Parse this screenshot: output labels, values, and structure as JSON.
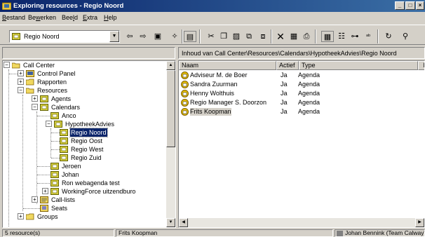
{
  "window": {
    "title": "Exploring resources - Regio Noord"
  },
  "menu": [
    {
      "pre": "",
      "u": "B",
      "post": "estand"
    },
    {
      "pre": "Be",
      "u": "w",
      "post": "erken"
    },
    {
      "pre": "Bee",
      "u": "l",
      "post": "d"
    },
    {
      "pre": "",
      "u": "E",
      "post": "xtra"
    },
    {
      "pre": "",
      "u": "H",
      "post": "elp"
    }
  ],
  "toolbar": {
    "location_value": "Regio Noord"
  },
  "path": {
    "text": "Inhoud van Call Center\\Resources\\Calendars\\HypotheekAdvies\\Regio Noord"
  },
  "tree": [
    {
      "label": "Call Center",
      "icon": "folder-open-icon"
    },
    {
      "label": "Control Panel",
      "icon": "control-panel-icon"
    },
    {
      "label": "Rapporten",
      "icon": "folder-icon"
    },
    {
      "label": "Resources",
      "icon": "folder-open-icon"
    },
    {
      "label": "Agents",
      "icon": "resource-icon"
    },
    {
      "label": "Calendars",
      "icon": "resource-icon"
    },
    {
      "label": "Anco",
      "icon": "resource-icon"
    },
    {
      "label": "HypotheekAdvies",
      "icon": "resource-icon"
    },
    {
      "label": "Regio Noord",
      "icon": "resource-icon"
    },
    {
      "label": "Regio Oost",
      "icon": "resource-icon"
    },
    {
      "label": "Regio West",
      "icon": "resource-icon"
    },
    {
      "label": "Regio Zuid",
      "icon": "resource-icon"
    },
    {
      "label": "Jeroen",
      "icon": "resource-icon"
    },
    {
      "label": "Johan",
      "icon": "resource-icon"
    },
    {
      "label": "Ron webagenda test",
      "icon": "resource-icon"
    },
    {
      "label": "WorkingForce uitzendburo",
      "icon": "resource-icon"
    },
    {
      "label": "Call-lists",
      "icon": "call-list-icon"
    },
    {
      "label": "Seats",
      "icon": "seat-icon"
    },
    {
      "label": "Groups",
      "icon": "folder-icon"
    }
  ],
  "list": {
    "columns": [
      "Naam",
      "Actief",
      "Type",
      "Pric"
    ],
    "rows": [
      {
        "name": "Adviseur M. de Boer",
        "active": "Ja",
        "type": "Agenda"
      },
      {
        "name": "Sandra Zuurman",
        "active": "Ja",
        "type": "Agenda"
      },
      {
        "name": "Henny Wolthuis",
        "active": "Ja",
        "type": "Agenda"
      },
      {
        "name": "Regio Manager S. Doorzon",
        "active": "Ja",
        "type": "Agenda"
      },
      {
        "name": "Frits Koopman",
        "active": "Ja",
        "type": "Agenda"
      }
    ]
  },
  "status": {
    "count": "5 resource(s)",
    "selected": "Frits Koopman",
    "user": "Johan Bennink (Team Calway\\J"
  }
}
